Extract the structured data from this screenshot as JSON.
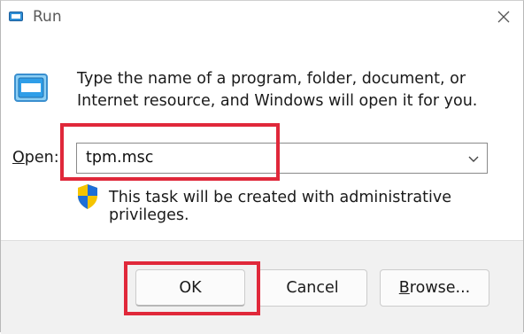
{
  "window": {
    "title": "Run",
    "icon": "run-app-icon",
    "close_icon": "close-icon"
  },
  "description": {
    "line1": "Type the name of a program, folder, document, or",
    "line2": "Internet resource, and Windows will open it for you."
  },
  "open": {
    "label_mnemonic": "O",
    "label_rest": "pen:",
    "value": "tpm.msc",
    "dropdown_icon": "chevron-down-icon"
  },
  "admin_note": {
    "icon": "uac-shield-icon",
    "text": "This task will be created with administrative privileges."
  },
  "buttons": {
    "ok": "OK",
    "cancel": "Cancel",
    "browse_mnemonic": "B",
    "browse_rest": "rowse..."
  },
  "colors": {
    "highlight": "#e0283a",
    "footer_bg": "#f1f1f1",
    "shield_blue": "#1e6fd9",
    "shield_yellow": "#f5c400"
  }
}
